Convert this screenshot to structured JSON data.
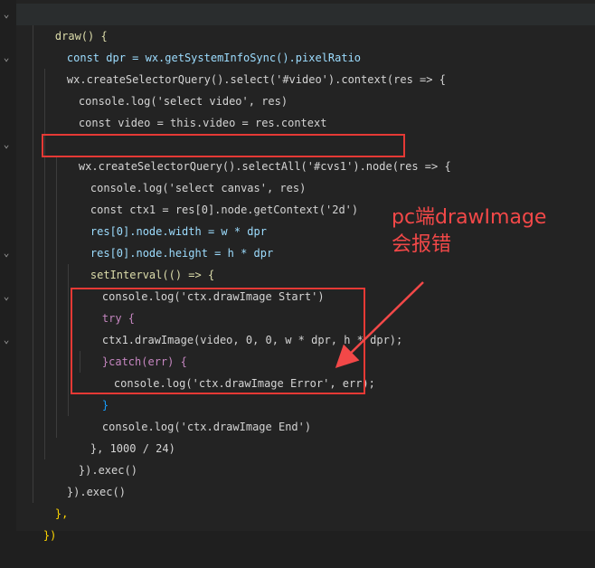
{
  "code_lines": [
    "draw() {",
    "const dpr = wx.getSystemInfoSync().pixelRatio",
    "wx.createSelectorQuery().select('#video').context(res => {",
    "console.log('select video', res)",
    "const video = this.video = res.context",
    "",
    "wx.createSelectorQuery().selectAll('#cvs1').node(res => {",
    "console.log('select canvas', res)",
    "const ctx1 = res[0].node.getContext('2d')",
    "res[0].node.width = w * dpr",
    "res[0].node.height = h * dpr",
    "setInterval(() => {",
    "console.log('ctx.drawImage Start')",
    "try {",
    "ctx1.drawImage(video, 0, 0, w * dpr, h * dpr);",
    "}catch(err) {",
    "console.log('ctx.drawImage Error', err);",
    "}",
    "console.log('ctx.drawImage End')",
    "}, 1000 / 24)",
    "}).exec()",
    "}).exec()",
    "},",
    "})"
  ],
  "annotation": {
    "line1": "pc端drawImage",
    "line2": "会报错"
  },
  "colors": {
    "annotation": "#f24848",
    "highlight_box": "#e53935",
    "background": "#1f1f1f"
  },
  "fold_icon": "chevron-down-icon"
}
